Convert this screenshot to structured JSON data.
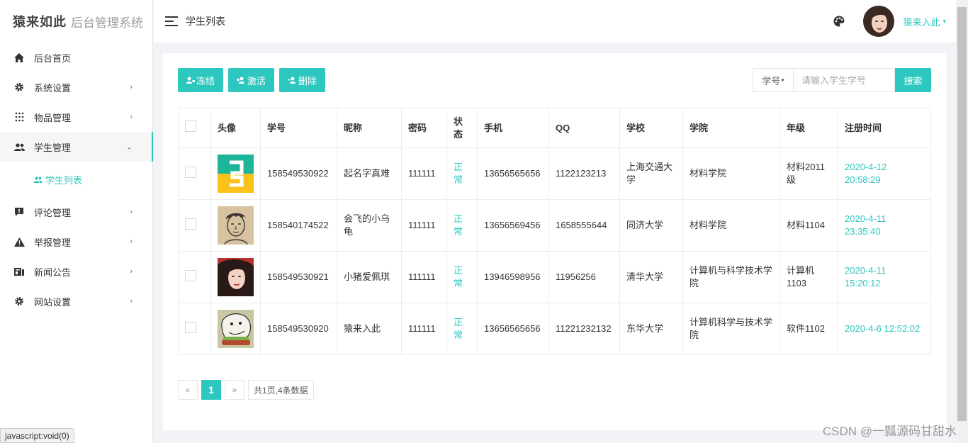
{
  "brand": {
    "name": "猿来如此",
    "subtitle": "后台管理系统"
  },
  "sidebar": {
    "items": [
      {
        "label": "后台首页",
        "icon": "home-icon",
        "arrow": ""
      },
      {
        "label": "系统设置",
        "icon": "gear-icon",
        "arrow": "›"
      },
      {
        "label": "物品管理",
        "icon": "grid-dots-icon",
        "arrow": "›"
      },
      {
        "label": "学生管理",
        "icon": "users-icon",
        "arrow": "⌄"
      },
      {
        "label": "评论管理",
        "icon": "comment-icon",
        "arrow": "›"
      },
      {
        "label": "举报管理",
        "icon": "warning-icon",
        "arrow": "›"
      },
      {
        "label": "新闻公告",
        "icon": "news-icon",
        "arrow": "›"
      },
      {
        "label": "网站设置",
        "icon": "gear-icon",
        "arrow": "›"
      }
    ],
    "submenu": {
      "label": "学生列表",
      "icon": "users-icon"
    }
  },
  "header": {
    "title": "学生列表",
    "username": "猿来入此",
    "caret": "▾"
  },
  "toolbar": {
    "freeze": "冻结",
    "activate": "激活",
    "delete": "删除"
  },
  "search": {
    "type": "学号",
    "caret": "▾",
    "placeholder": "请输入学生学号",
    "button": "搜索"
  },
  "table": {
    "headers": [
      "头像",
      "学号",
      "昵称",
      "密码",
      "状态",
      "手机",
      "QQ",
      "学校",
      "学院",
      "年级",
      "注册时间"
    ],
    "rows": [
      {
        "id": "158549530922",
        "nickname": "起名字真难",
        "password": "111111",
        "status": "正常",
        "phone": "13656565656",
        "qq": "1122123213",
        "school": "上海交通大学",
        "college": "材料学院",
        "grade": "材料2011级",
        "registered": "2020-4-12 20:58:29"
      },
      {
        "id": "158540174522",
        "nickname": "会飞的小乌龟",
        "password": "111111",
        "status": "正常",
        "phone": "13656569456",
        "qq": "1658555644",
        "school": "同济大学",
        "college": "材料学院",
        "grade": "材料1104",
        "registered": "2020-4-11 23:35:40"
      },
      {
        "id": "158549530921",
        "nickname": "小猪爱佩琪",
        "password": "111111",
        "status": "正常",
        "phone": "13946598956",
        "qq": "11956256",
        "school": "清华大学",
        "college": "计算机与科学技术学院",
        "grade": "计算机1103",
        "registered": "2020-4-11 15:20:12"
      },
      {
        "id": "158549530920",
        "nickname": "猿来入此",
        "password": "111111",
        "status": "正常",
        "phone": "13656565656",
        "qq": "11221232132",
        "school": "东华大学",
        "college": "计算机科学与技术学院",
        "grade": "软件1102",
        "registered": "2020-4-6 12:52:02"
      }
    ]
  },
  "pagination": {
    "prev": "«",
    "current": "1",
    "next": "»",
    "summary": "共1页,4条数据"
  },
  "statusbar": "javascript:void(0)",
  "watermark": "CSDN @一瓢源码甘甜水",
  "colors": {
    "accent": "#2ec7c0"
  }
}
